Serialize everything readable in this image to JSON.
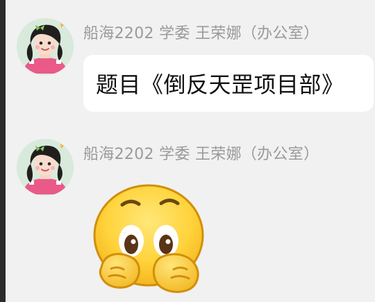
{
  "messages": [
    {
      "sender": "船海2202 学委 王荣娜（办公室）",
      "text": "题目《倒反天罡项目部》",
      "type": "text",
      "avatar_icon": "girl-avatar-icon"
    },
    {
      "sender": "船海2202 学委 王荣娜（办公室）",
      "type": "sticker",
      "avatar_icon": "girl-avatar-icon",
      "sticker_icon": "peeking-face-emoji-icon"
    }
  ],
  "colors": {
    "background": "#f1f1f1",
    "bubble": "#ffffff",
    "sender_text": "#9a9a9a",
    "message_text": "#111111"
  }
}
